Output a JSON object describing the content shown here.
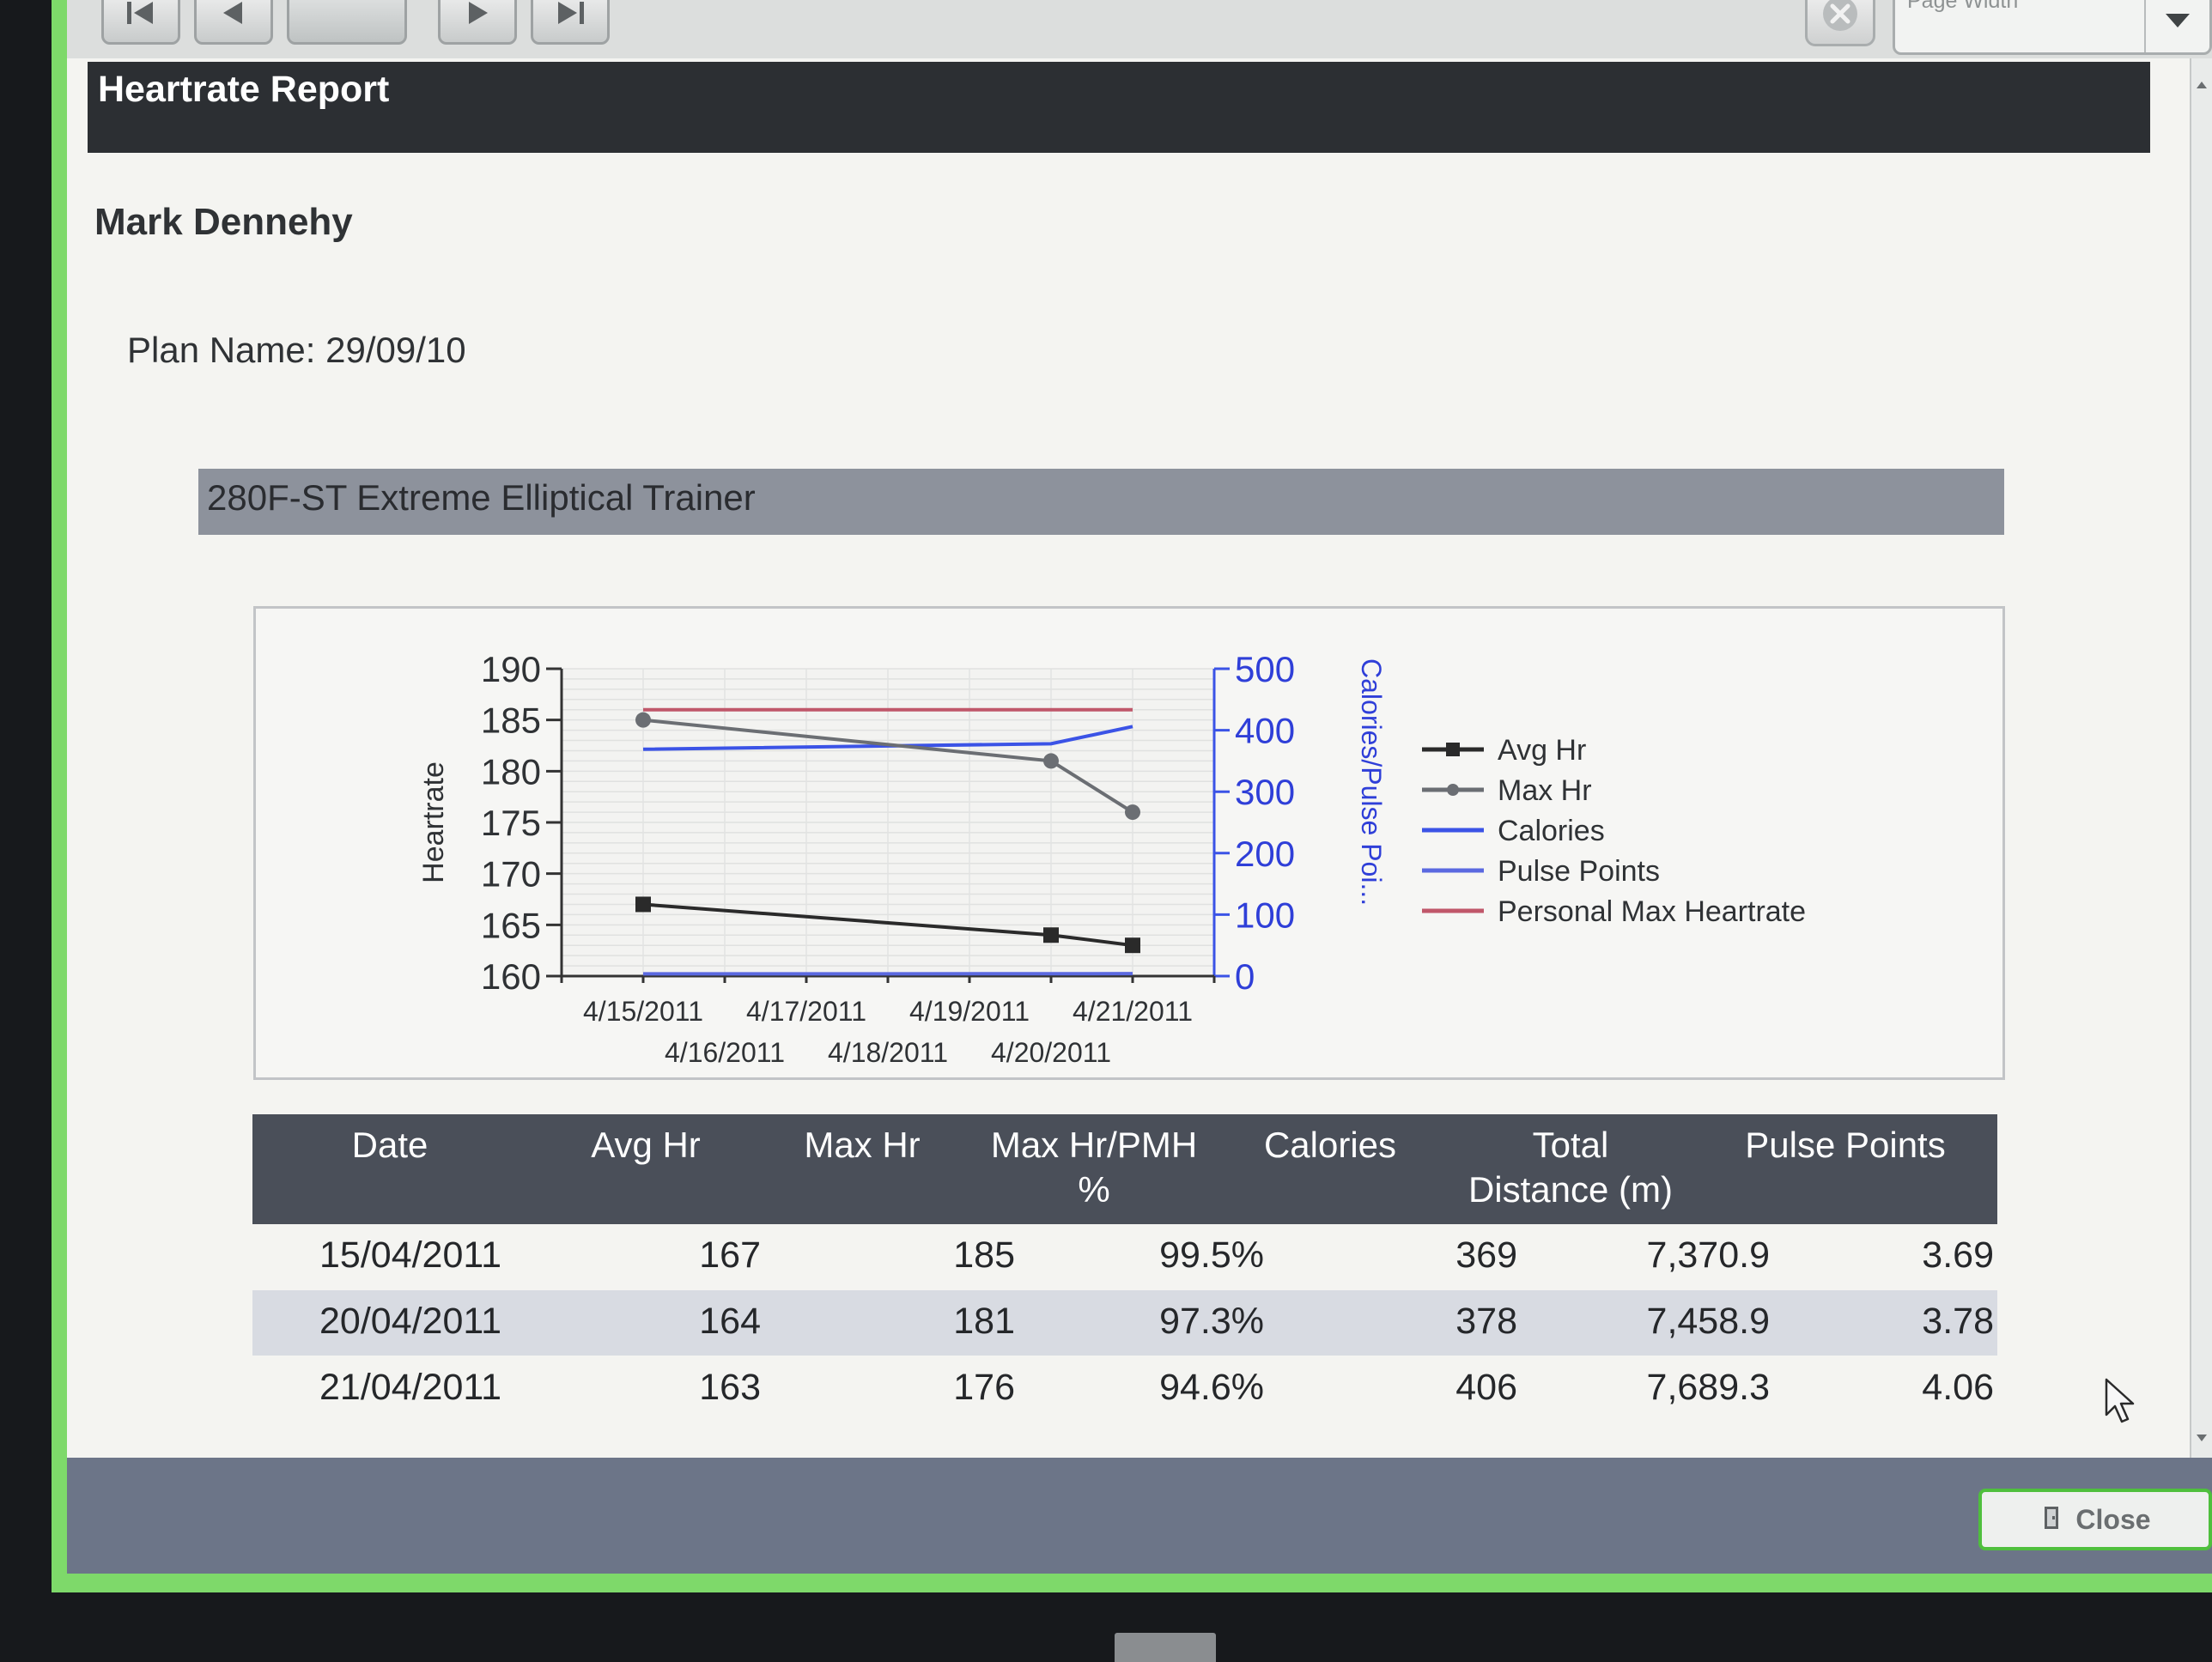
{
  "toolbar": {
    "zoom_value": "Page Width",
    "icons": [
      "first-page-icon",
      "previous-page-icon",
      "page-number-box",
      "next-page-icon",
      "last-page-icon",
      "stop-icon",
      "chevron-down-icon"
    ]
  },
  "report": {
    "title": "Heartrate Report",
    "user_name": "Mark Dennehy",
    "plan_name": "Plan Name: 29/09/10",
    "device_name": "280F-ST Extreme Elliptical Trainer"
  },
  "chart_data": {
    "type": "line",
    "title": "",
    "ylabel": "Heartrate",
    "y2label": "Calories/Pulse Poi...",
    "x_axis": {
      "type": "date",
      "min": "2011-04-14",
      "max": "2011-04-22",
      "tick_labels_row1": [
        "4/15/2011",
        "4/17/2011",
        "4/19/2011",
        "4/21/2011"
      ],
      "tick_labels_row2": [
        "4/16/2011",
        "4/18/2011",
        "4/20/2011"
      ]
    },
    "ylim": [
      160,
      190
    ],
    "yticks": [
      160,
      165,
      170,
      175,
      180,
      185,
      190
    ],
    "y2lim": [
      0,
      500
    ],
    "y2ticks": [
      0,
      100,
      200,
      300,
      400,
      500
    ],
    "grid": true,
    "legend_position": "right",
    "series": [
      {
        "name": "Avg Hr",
        "axis": "left",
        "color": "#2a2a2a",
        "marker": "square",
        "x": [
          "2011-04-15",
          "2011-04-20",
          "2011-04-21"
        ],
        "y": [
          167,
          164,
          163
        ]
      },
      {
        "name": "Max Hr",
        "axis": "left",
        "color": "#6b6e73",
        "marker": "circle",
        "x": [
          "2011-04-15",
          "2011-04-20",
          "2011-04-21"
        ],
        "y": [
          185,
          181,
          176
        ]
      },
      {
        "name": "Calories",
        "axis": "right",
        "color": "#3b53e6",
        "marker": "none",
        "x": [
          "2011-04-15",
          "2011-04-20",
          "2011-04-21"
        ],
        "y": [
          369,
          378,
          406
        ]
      },
      {
        "name": "Pulse Points",
        "axis": "right",
        "color": "#5b69e0",
        "marker": "none",
        "x": [
          "2011-04-15",
          "2011-04-20",
          "2011-04-21"
        ],
        "y": [
          3.69,
          3.78,
          4.06
        ]
      },
      {
        "name": "Personal Max Heartrate",
        "axis": "left",
        "color": "#c0576a",
        "marker": "none",
        "x": [
          "2011-04-15",
          "2011-04-21"
        ],
        "y": [
          186,
          186
        ]
      }
    ]
  },
  "table": {
    "headers": [
      {
        "line1": "Date",
        "line2": ""
      },
      {
        "line1": "Avg Hr",
        "line2": ""
      },
      {
        "line1": "Max Hr",
        "line2": ""
      },
      {
        "line1": "Max Hr/PMH",
        "line2": "%"
      },
      {
        "line1": "Calories",
        "line2": ""
      },
      {
        "line1": "Total",
        "line2": "Distance (m)"
      },
      {
        "line1": "Pulse Points",
        "line2": ""
      }
    ],
    "rows": [
      [
        "15/04/2011",
        "167",
        "185",
        "99.5%",
        "369",
        "7,370.9",
        "3.69"
      ],
      [
        "20/04/2011",
        "164",
        "181",
        "97.3%",
        "378",
        "7,458.9",
        "3.78"
      ],
      [
        "21/04/2011",
        "163",
        "176",
        "94.6%",
        "406",
        "7,689.3",
        "4.06"
      ]
    ]
  },
  "footer": {
    "close_label": "Close"
  }
}
